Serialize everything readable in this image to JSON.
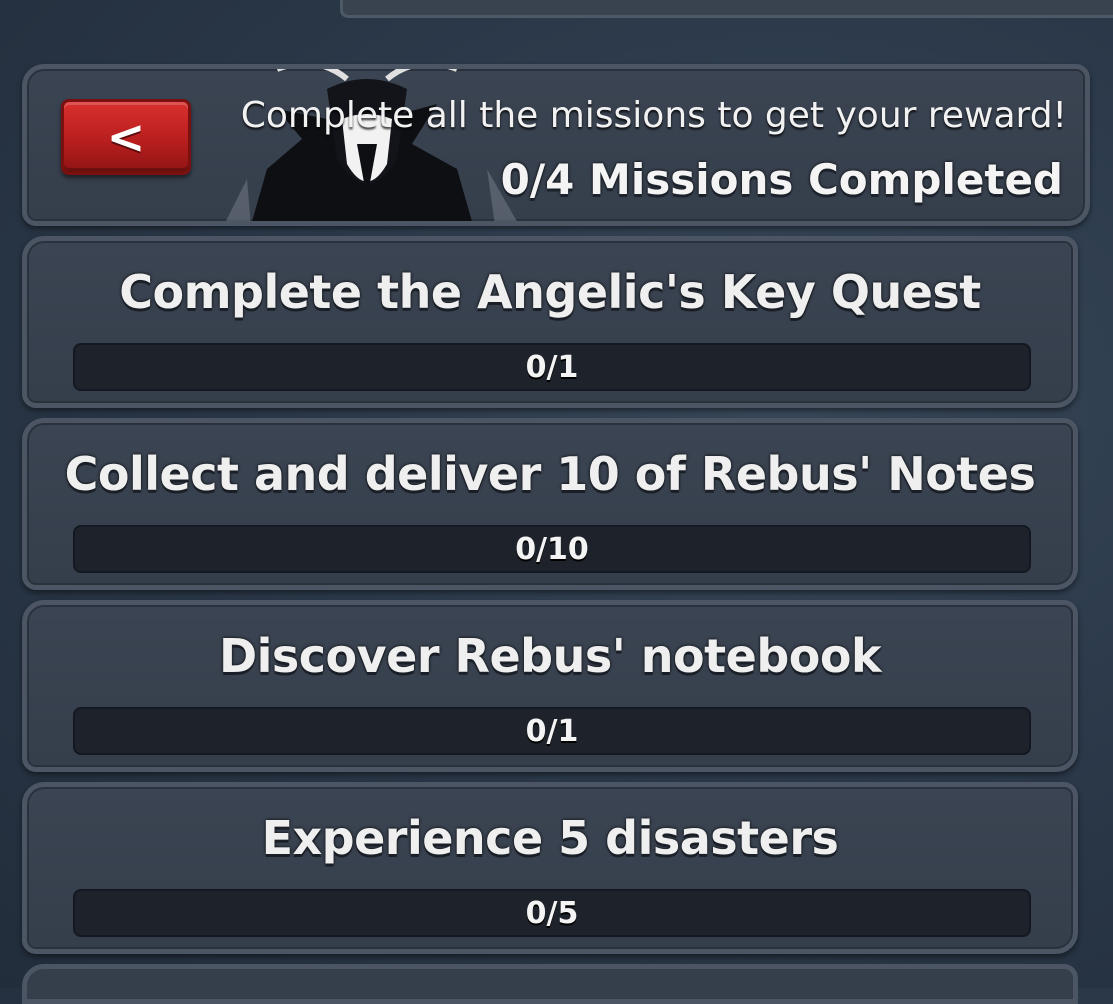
{
  "header": {
    "back_label": "<",
    "subtitle": "Complete all the missions to get your reward!",
    "progress_summary": "0/4 Missions Completed"
  },
  "missions": [
    {
      "title": "Complete the Angelic's Key Quest",
      "progress_text": "0/1",
      "progress": 0
    },
    {
      "title": "Collect and deliver 10 of Rebus' Notes",
      "progress_text": "0/10",
      "progress": 0
    },
    {
      "title": "Discover Rebus' notebook",
      "progress_text": "0/1",
      "progress": 0
    },
    {
      "title": "Experience 5 disasters",
      "progress_text": "0/5",
      "progress": 0
    }
  ],
  "colors": {
    "back_button": "#c62828",
    "panel_bg": "#38414e",
    "panel_border": "#4b5563",
    "progress_track": "#1e232b",
    "progress_fill": "#4cc36a"
  }
}
